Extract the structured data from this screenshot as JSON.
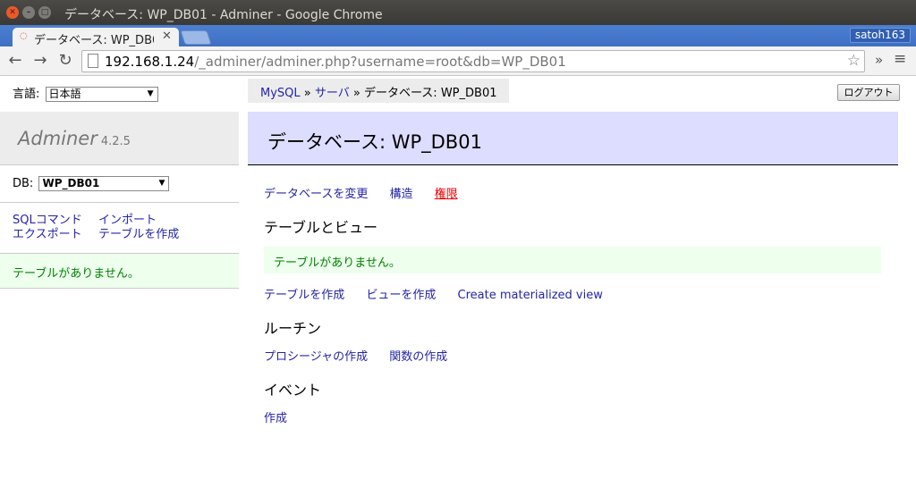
{
  "window": {
    "title": "データベース: WP_DB01 - Adminer - Google Chrome"
  },
  "tab": {
    "title": "データベース: WP_DB01 - Adminer"
  },
  "profile": {
    "name": "satoh163"
  },
  "omnibox": {
    "host": "192.168.1.24",
    "path": "/_adminer/adminer.php?username=root&db=WP_DB01"
  },
  "sidebar": {
    "lang_label": "言語:",
    "lang_selected": "日本語",
    "app_name": "Adminer",
    "version": "4.2.5",
    "db_label": "DB:",
    "db_selected": "WP_DB01",
    "links": {
      "sql": "SQLコマンド",
      "import": "インポート",
      "export": "エクスポート",
      "create_table": "テーブルを作成"
    },
    "notice": "テーブルがありません。"
  },
  "breadcrumb": {
    "mysql": "MySQL",
    "sep": " » ",
    "server": "サーバ",
    "current": "データベース: WP_DB01"
  },
  "logout_label": "ログアウト",
  "main": {
    "title": "データベース: WP_DB01",
    "actions": {
      "alter": "データベースを変更",
      "schema": "構造",
      "privileges": "権限"
    },
    "tables_title": "テーブルとビュー",
    "tables_notice": "テーブルがありません。",
    "table_links": {
      "create_table": "テーブルを作成",
      "create_view": "ビューを作成",
      "create_mview": "Create materialized view"
    },
    "routines_title": "ルーチン",
    "routine_links": {
      "procedure": "プロシージャの作成",
      "function": "関数の作成"
    },
    "events_title": "イベント",
    "event_links": {
      "create": "作成"
    }
  }
}
